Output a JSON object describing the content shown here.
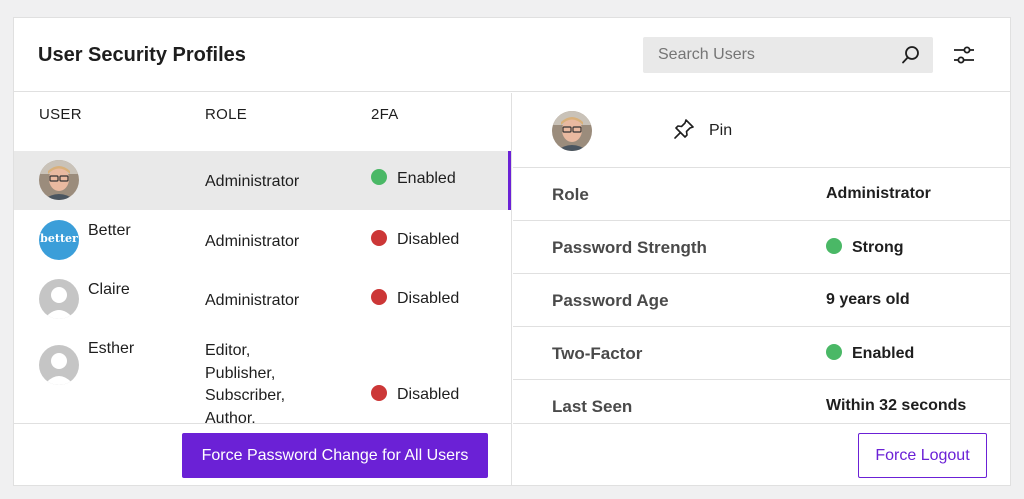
{
  "header": {
    "title": "User Security Profiles",
    "search_placeholder": "Search Users",
    "search_icon": "search-icon",
    "filter_icon": "sliders-icon"
  },
  "table": {
    "columns": [
      "USER",
      "ROLE",
      "2FA"
    ],
    "rows": [
      {
        "name": "",
        "avatar": "photo",
        "role": "Administrator",
        "twofa": "Enabled",
        "status": "enabled",
        "selected": true
      },
      {
        "name": "Better",
        "avatar": "better",
        "role": "Administrator",
        "twofa": "Disabled",
        "status": "disabled"
      },
      {
        "name": "Claire",
        "avatar": "default",
        "role": "Administrator",
        "twofa": "Disabled",
        "status": "disabled"
      },
      {
        "name": "Esther",
        "avatar": "default",
        "role": "Editor,\nPublisher,\nSubscriber,\nAuthor,\nAdministrator",
        "twofa": "Disabled",
        "status": "disabled"
      }
    ]
  },
  "avatar_texts": {
    "better": "better"
  },
  "details": {
    "pin_label": "Pin",
    "pin_icon": "pin-icon",
    "rows": [
      {
        "label": "Role",
        "value": "Administrator",
        "status": ""
      },
      {
        "label": "Password Strength",
        "value": "Strong",
        "status": "enabled"
      },
      {
        "label": "Password Age",
        "value": "9 years old",
        "status": ""
      },
      {
        "label": "Two-Factor",
        "value": "Enabled",
        "status": "enabled"
      },
      {
        "label": "Last Seen",
        "value": "Within 32 seconds",
        "status": ""
      }
    ]
  },
  "footer": {
    "force_password_label": "Force Password Change for All Users",
    "force_logout_label": "Force Logout"
  },
  "colors": {
    "accent": "#6b21d6",
    "enabled": "#4ab866",
    "disabled": "#cc3737",
    "better_brand": "#3b9ed9"
  }
}
